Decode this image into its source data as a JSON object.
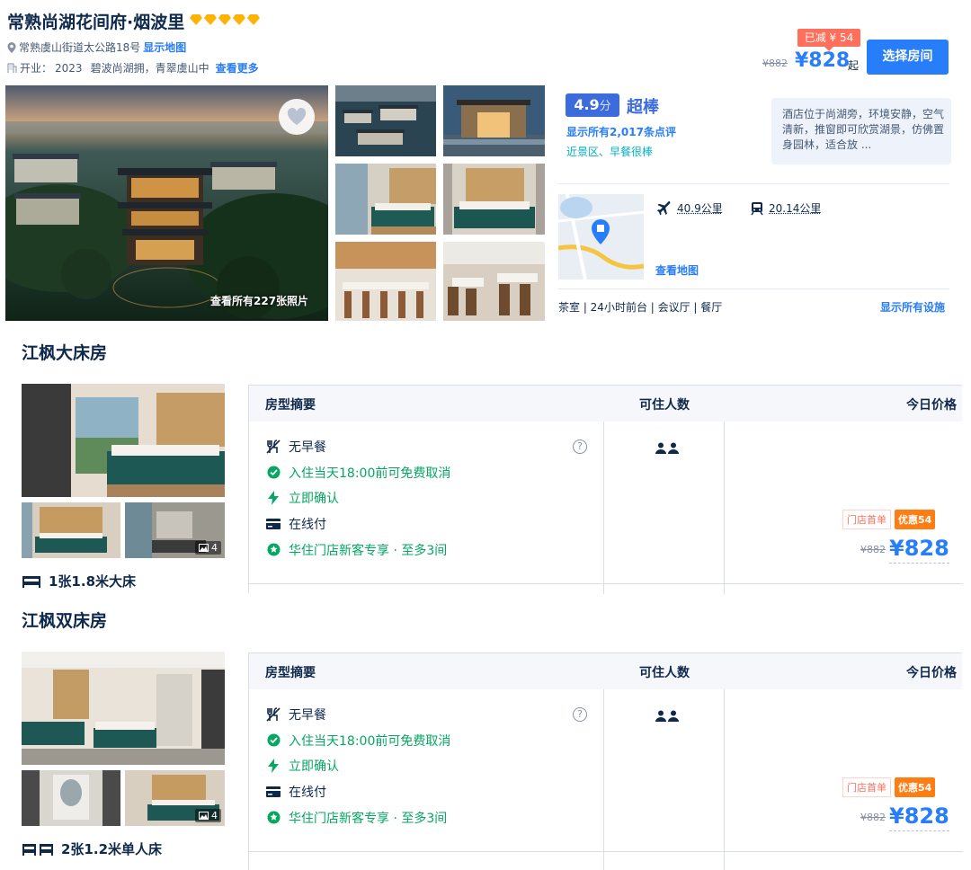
{
  "hotel": {
    "name": "常熟尚湖花间府·烟波里",
    "rating_diamonds": 5,
    "address": "常熟虞山街道太公路18号",
    "show_map_link": "显示地图",
    "opened_label": "开业：",
    "opened_year": "2023",
    "tagline": "碧波尚湖拥，青翠虞山中",
    "see_more_link": "查看更多"
  },
  "price_top": {
    "discount_badge": "已减 ¥ 54",
    "original": "¥882",
    "price": "¥828",
    "suffix": "起",
    "select_button": "选择房间"
  },
  "gallery": {
    "all_photos": "查看所有227张照片"
  },
  "review": {
    "score": "4.9",
    "score_unit": "分",
    "score_word": "超棒",
    "all_reviews_link": "显示所有2,017条点评",
    "tags": "近景区、早餐很棒",
    "snippet": "酒店位于尚湖旁，环境安静，空气清新，推窗即可欣赏湖景，仿佛置身园林，适合放 ..."
  },
  "location": {
    "airport_distance": "40.9公里",
    "station_distance": "20.14公里",
    "view_map_link": "查看地图"
  },
  "facilities": {
    "list": "茶室 | 24小时前台 | 会议厅 | 餐厅",
    "show_all_link": "显示所有设施"
  },
  "colors": {
    "primary_blue": "#287dfa",
    "score_blue": "#3b6bdc",
    "green": "#06a663",
    "orange": "#ff7d13",
    "red_badge": "#ff6f5b"
  },
  "table_headers": {
    "summary": "房型摘要",
    "occupancy": "可住人数",
    "price": "今日价格"
  },
  "rooms": [
    {
      "name": "江枫大床房",
      "photo_count": "4",
      "bed": "1张1.8米大床",
      "bed_icon": "double-bed-icon",
      "features": {
        "breakfast": "无早餐",
        "cancel": "入住当天18:00前可免费取消",
        "confirm": "立即确认",
        "payment": "在线付",
        "member": "华住门店新客专享 · 至多3间"
      },
      "promo_first": "门店首单",
      "promo_discount": "优惠54",
      "original_price": "¥882",
      "price": "¥828"
    },
    {
      "name": "江枫双床房",
      "photo_count": "4",
      "bed": "2张1.2米单人床",
      "bed_icon": "twin-bed-icon",
      "features": {
        "breakfast": "无早餐",
        "cancel": "入住当天18:00前可免费取消",
        "confirm": "立即确认",
        "payment": "在线付",
        "member": "华住门店新客专享 · 至多3间"
      },
      "promo_first": "门店首单",
      "promo_discount": "优惠54",
      "original_price": "¥882",
      "price": "¥828"
    }
  ]
}
